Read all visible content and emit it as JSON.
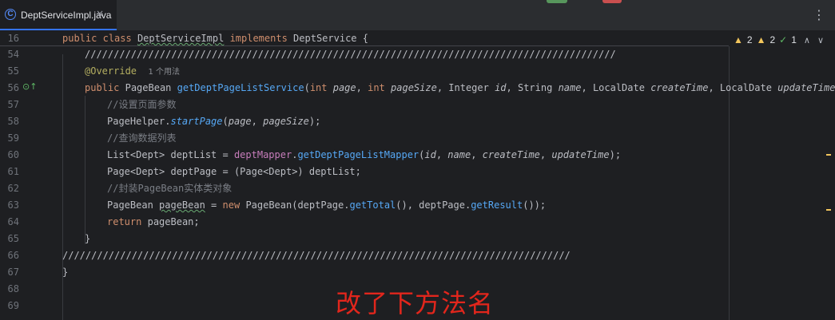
{
  "tab": {
    "icon": "class-icon",
    "title": "DeptServiceImpl.java",
    "close": "×"
  },
  "toolbar": {
    "more": "⋮"
  },
  "inspections": {
    "warnings_a": "2",
    "warnings_b": "2",
    "ok": "1"
  },
  "lines": [
    {
      "num": "16"
    },
    {
      "num": "54"
    },
    {
      "num": "55"
    },
    {
      "num": "56"
    },
    {
      "num": "57"
    },
    {
      "num": "58"
    },
    {
      "num": "59"
    },
    {
      "num": "60"
    },
    {
      "num": "61"
    },
    {
      "num": "62"
    },
    {
      "num": "63"
    },
    {
      "num": "64"
    },
    {
      "num": "65"
    },
    {
      "num": "66"
    },
    {
      "num": "67"
    },
    {
      "num": "68"
    },
    {
      "num": "69"
    }
  ],
  "code": {
    "l16": {
      "public": "public",
      "class": "class",
      "name": "DeptServiceImpl",
      "implements": "implements",
      "iface": "DeptService",
      "brace": " {"
    },
    "l54": "////////////////////////////////////////////////////////////////////////////////////////////",
    "l55": {
      "ann": "@Override",
      "hint": "1 个用法"
    },
    "l56": {
      "public": "public",
      "ret": "PageBean",
      "fn": "getDeptPageListService",
      "sig_open": "(",
      "int1": "int",
      "p1": "page",
      "int2": "int",
      "p2": "pageSize",
      "t3": "Integer",
      "p3": "id",
      "t4": "String",
      "p4": "name",
      "t5": "LocalDate",
      "p5": "createTime",
      "t6": "LocalDate",
      "p6": "updateTime",
      "sig_close": ") {"
    },
    "l57": "//设置页面参数",
    "l58": {
      "obj": "PageHelper",
      "fn": "startPage",
      "p1": "page",
      "p2": "pageSize"
    },
    "l59": "//查询数据列表",
    "l60": {
      "type": "List<Dept> deptList = ",
      "field": "deptMapper",
      "fn": "getDeptPageListMapper",
      "p1": "id",
      "p2": "name",
      "p3": "createTime",
      "p4": "updateTime"
    },
    "l61": "Page<Dept> deptPage = (Page<Dept>) deptList;",
    "l62": "//封装PageBean实体类对象",
    "l63": {
      "type": "PageBean ",
      "var": "pageBean",
      "eq": " = ",
      "new": "new",
      "ctor": "PageBean",
      "a": "(deptPage.",
      "g1": "getTotal",
      "b": "(), deptPage.",
      "g2": "getResult",
      "c": "());"
    },
    "l64": {
      "ret": "return",
      "var": "pageBean;"
    },
    "l65": "}",
    "l66": "////////////////////////////////////////////////////////////////////////////////////////",
    "l67": "}"
  },
  "annotation_text": "改了下方法名"
}
